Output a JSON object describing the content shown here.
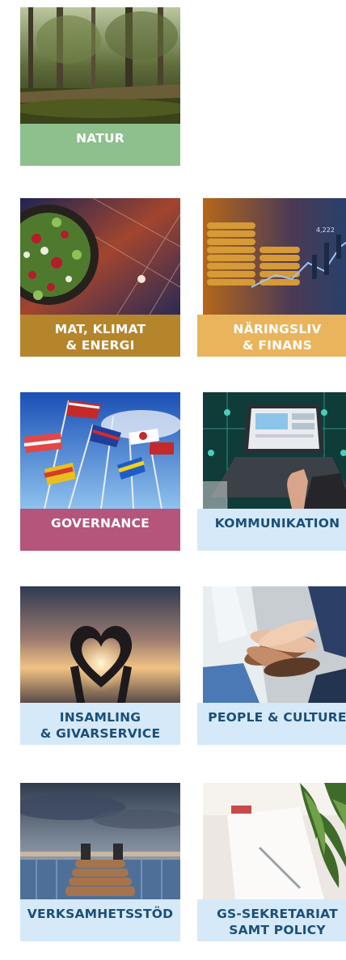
{
  "tiles": [
    {
      "id": "natur",
      "lines": [
        "NATUR"
      ],
      "bg": "#8ec08d",
      "fg": "#ffffff"
    },
    {
      "id": "mat-klimat-energi",
      "lines": [
        "MAT, KLIMAT",
        "& ENERGI"
      ],
      "bg": "#b5852c",
      "fg": "#ffffff"
    },
    {
      "id": "naringsliv-finans",
      "lines": [
        "NÄRINGSLIV",
        "& FINANS"
      ],
      "bg": "#e9b45c",
      "fg": "#ffffff"
    },
    {
      "id": "governance",
      "lines": [
        "GOVERNANCE"
      ],
      "bg": "#b5557b",
      "fg": "#ffffff"
    },
    {
      "id": "kommunikation",
      "lines": [
        "KOMMUNIKATION"
      ],
      "bg": "#d5e9f8",
      "fg": "#1c4f78"
    },
    {
      "id": "insamling-givarservice",
      "lines": [
        "INSAMLING",
        "& GIVARSERVICE"
      ],
      "bg": "#d5e9f8",
      "fg": "#1c4f78"
    },
    {
      "id": "people-culture",
      "lines": [
        "PEOPLE & CULTURE"
      ],
      "bg": "#d5e9f8",
      "fg": "#1c4f78"
    },
    {
      "id": "verksamhetsstod",
      "lines": [
        "VERKSAMHETSSTÖD"
      ],
      "bg": "#d5e9f8",
      "fg": "#1c4f78"
    },
    {
      "id": "gs-sekretariat-policy",
      "lines": [
        "GS-SEKRETARIAT",
        "SAMT POLICY"
      ],
      "bg": "#d5e9f8",
      "fg": "#1c4f78"
    }
  ]
}
